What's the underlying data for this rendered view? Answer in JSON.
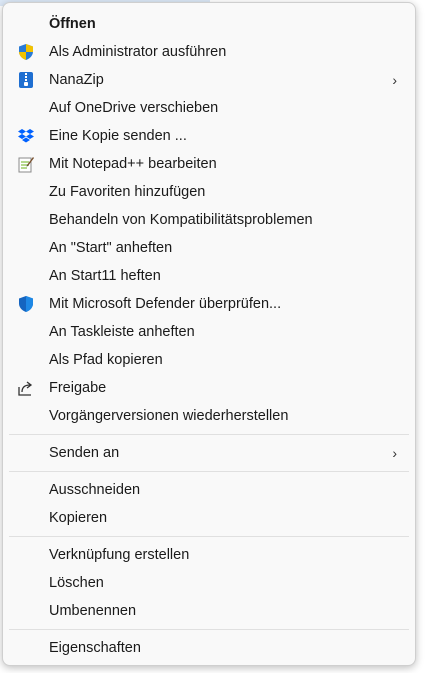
{
  "menu": {
    "items": [
      {
        "label": "Öffnen",
        "icon": "none",
        "bold": true
      },
      {
        "label": "Als Administrator ausführen",
        "icon": "uac-shield-icon"
      },
      {
        "label": "NanaZip",
        "icon": "nanazip-icon",
        "submenu": true
      },
      {
        "label": "Auf OneDrive verschieben",
        "icon": "none"
      },
      {
        "label": "Eine Kopie senden ...",
        "icon": "dropbox-icon"
      },
      {
        "label": "Mit Notepad++ bearbeiten",
        "icon": "notepadpp-icon"
      },
      {
        "label": "Zu Favoriten hinzufügen",
        "icon": "none"
      },
      {
        "label": "Behandeln von Kompatibilitätsproblemen",
        "icon": "none"
      },
      {
        "label": "An \"Start\" anheften",
        "icon": "none"
      },
      {
        "label": "An Start11 heften",
        "icon": "none"
      },
      {
        "label": "Mit Microsoft Defender überprüfen...",
        "icon": "defender-shield-icon"
      },
      {
        "label": "An Taskleiste anheften",
        "icon": "none"
      },
      {
        "label": "Als Pfad kopieren",
        "icon": "none"
      },
      {
        "label": "Freigabe",
        "icon": "share-icon"
      },
      {
        "label": "Vorgängerversionen wiederherstellen",
        "icon": "none"
      }
    ],
    "send_to": {
      "label": "Senden an",
      "submenu": true
    },
    "clipboard": [
      {
        "label": "Ausschneiden"
      },
      {
        "label": "Kopieren"
      }
    ],
    "file_ops": [
      {
        "label": "Verknüpfung erstellen"
      },
      {
        "label": "Löschen"
      },
      {
        "label": "Umbenennen"
      }
    ],
    "properties": {
      "label": "Eigenschaften"
    },
    "chevron": "›"
  }
}
